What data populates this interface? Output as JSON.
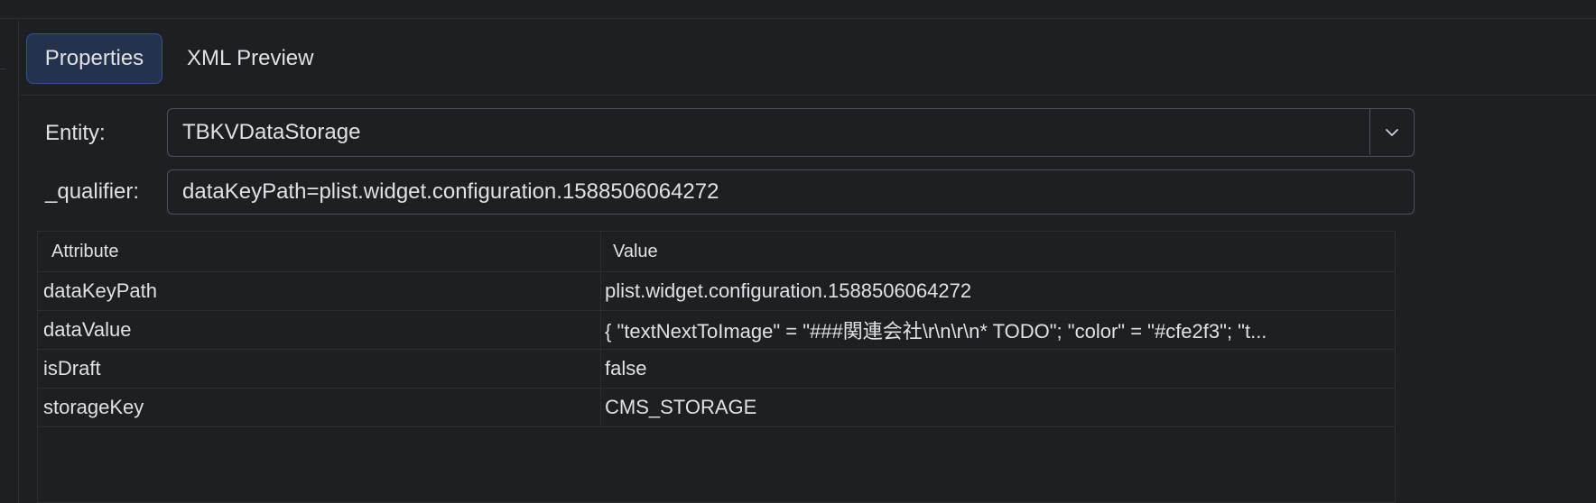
{
  "tabs": [
    {
      "label": "Properties",
      "active": true
    },
    {
      "label": "XML Preview",
      "active": false
    }
  ],
  "form": {
    "entity_label": "Entity:",
    "entity_value": "TBKVDataStorage",
    "qualifier_label": "_qualifier:",
    "qualifier_value": "dataKeyPath=plist.widget.configuration.1588506064272"
  },
  "table": {
    "headers": [
      "Attribute",
      "Value"
    ],
    "rows": [
      {
        "attribute": "dataKeyPath",
        "value": "plist.widget.configuration.1588506064272"
      },
      {
        "attribute": "dataValue",
        "value": "{  \"textNextToImage\" = \"###関連会社\\r\\n\\r\\n* TODO\";  \"color\" = \"#cfe2f3\";  \"t..."
      },
      {
        "attribute": "isDraft",
        "value": "false"
      },
      {
        "attribute": "storageKey",
        "value": "CMS_STORAGE"
      }
    ]
  },
  "colors": {
    "background": "#1e1f22",
    "active_tab_bg": "#25324d",
    "active_tab_border": "#35538f",
    "border": "#4e5157",
    "text": "#dfe1e5"
  },
  "icons": {
    "entity_dropdown": "chevron-down-icon"
  }
}
